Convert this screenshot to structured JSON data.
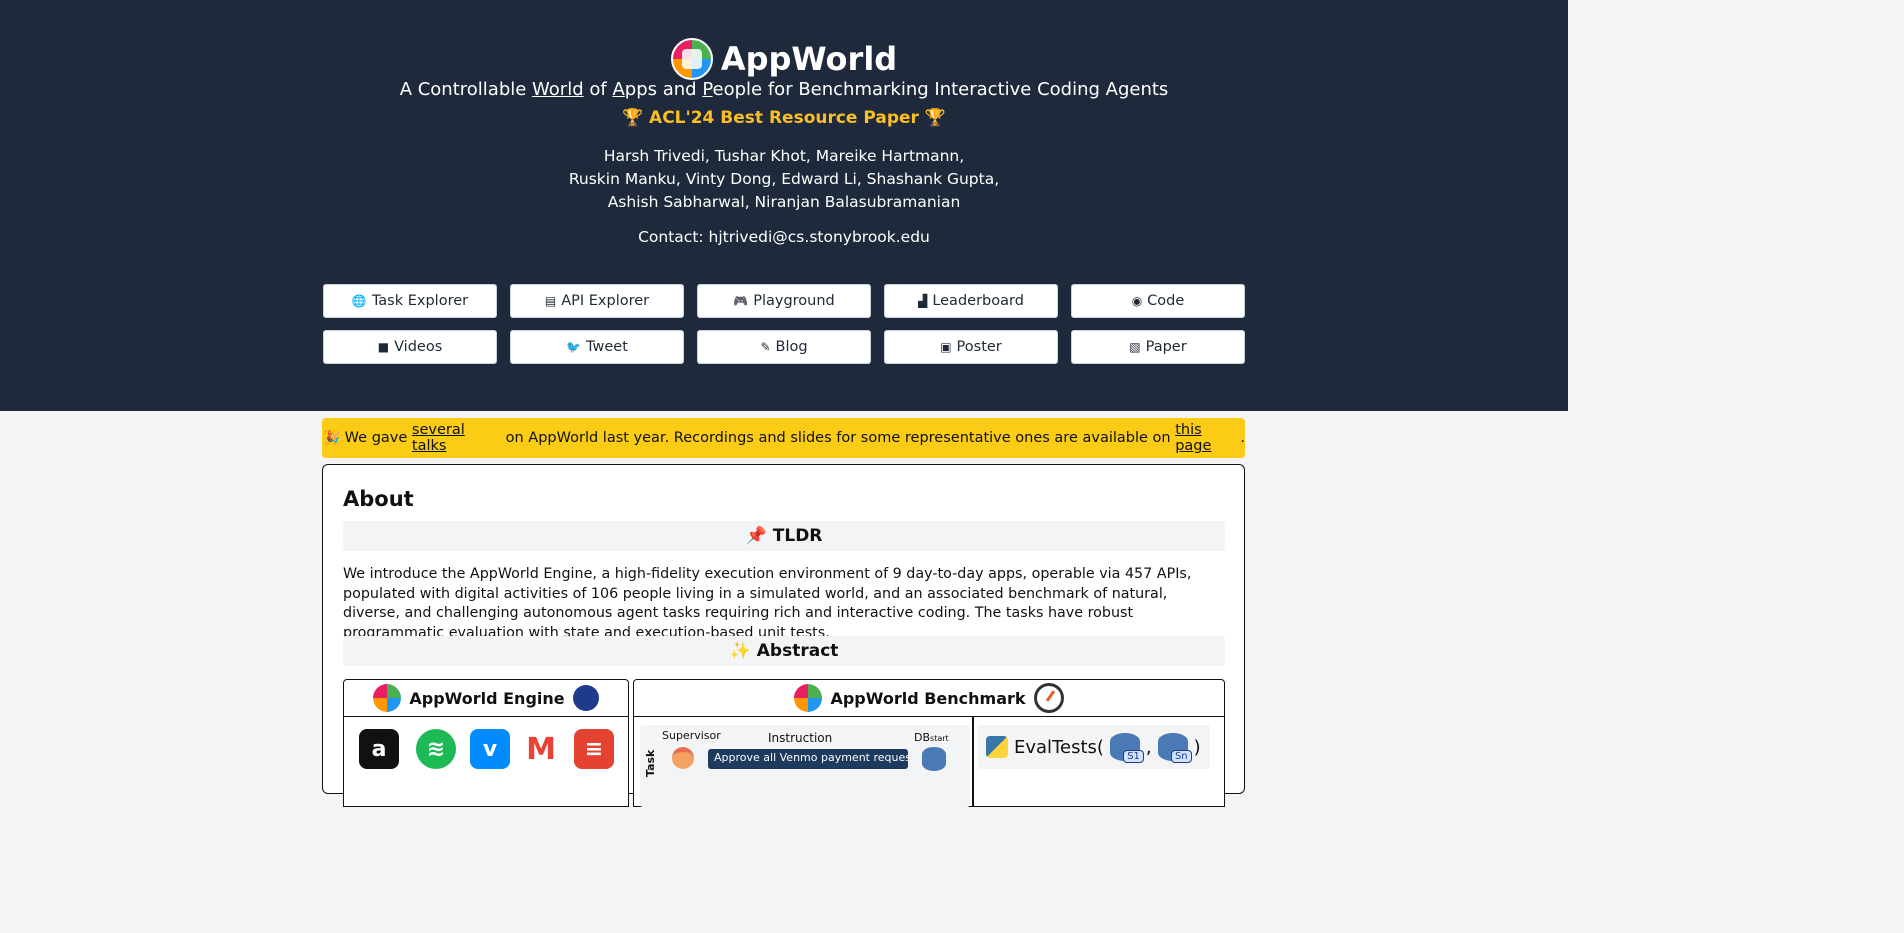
{
  "header": {
    "title": "AppWorld",
    "subtitle_parts": [
      "A Controllable ",
      "World",
      " of ",
      "A",
      "pps and ",
      "P",
      "eople for Benchmarking Interactive Coding Agents"
    ],
    "award": "🏆  ACL'24 Best Resource Paper  🏆",
    "authors": [
      "Harsh Trivedi, Tushar Khot, Mareike Hartmann,",
      "Ruskin Manku, Vinty Dong, Edward Li, Shashank Gupta,",
      "Ashish Sabharwal, Niranjan Balasubramanian"
    ],
    "contact": "Contact: hjtrivedi@cs.stonybrook.edu"
  },
  "nav_buttons": [
    {
      "label": "Task Explorer",
      "icon": "globe-icon",
      "glyph": "🌐"
    },
    {
      "label": "API Explorer",
      "icon": "file-code-icon",
      "glyph": "▤"
    },
    {
      "label": "Playground",
      "icon": "gamepad-icon",
      "glyph": "🎮"
    },
    {
      "label": "Leaderboard",
      "icon": "ranking-icon",
      "glyph": "▟"
    },
    {
      "label": "Code",
      "icon": "github-icon",
      "glyph": "◉"
    },
    {
      "label": "Videos",
      "icon": "video-icon",
      "glyph": "■"
    },
    {
      "label": "Tweet",
      "icon": "twitter-icon",
      "glyph": "🐦"
    },
    {
      "label": "Blog",
      "icon": "blog-icon",
      "glyph": "✎"
    },
    {
      "label": "Poster",
      "icon": "image-icon",
      "glyph": "▣"
    },
    {
      "label": "Paper",
      "icon": "pdf-icon",
      "glyph": "▧"
    }
  ],
  "banner": {
    "emoji": "🎉",
    "text_before": " We gave ",
    "link1": "several talks",
    "text_middle": " on AppWorld last year. Recordings and slides for some representative ones are available on ",
    "link2": "this page",
    "text_after": "."
  },
  "about": {
    "title": "About",
    "tldr_heading": "TLDR",
    "tldr_emoji": "📌",
    "tldr_text": "We introduce the AppWorld Engine, a high-fidelity execution environment of 9 day-to-day apps, operable via 457 APIs, populated with digital activities of 106 people living in a simulated world, and an associated benchmark of natural, diverse, and challenging autonomous agent tasks requiring rich and interactive coding. The tasks have robust programmatic evaluation with state and execution-based unit tests.",
    "abstract_heading": "Abstract",
    "abstract_emoji": "✨"
  },
  "figure": {
    "engine_title": "AppWorld Engine",
    "benchmark_title": "AppWorld Benchmark",
    "apps": [
      {
        "name": "amazon-icon",
        "glyph": "a",
        "color": "#111111"
      },
      {
        "name": "spotify-icon",
        "glyph": "≋",
        "color": "#1db954"
      },
      {
        "name": "venmo-icon",
        "glyph": "v",
        "color": "#008cff"
      },
      {
        "name": "gmail-icon",
        "glyph": "M",
        "color": "#ffffff"
      },
      {
        "name": "todoist-icon",
        "glyph": "≡",
        "color": "#e44332"
      }
    ],
    "task_label": "Task",
    "supervisor_label": "Supervisor",
    "instruction_label": "Instruction",
    "db_label": "DB",
    "db_sub": "start",
    "instruction_text": "Approve all Venmo payment requests",
    "eval_label": "EvalTests(",
    "eval_close": ")",
    "eval_sep": ",",
    "s1": "S1",
    "sn": "Sn"
  }
}
